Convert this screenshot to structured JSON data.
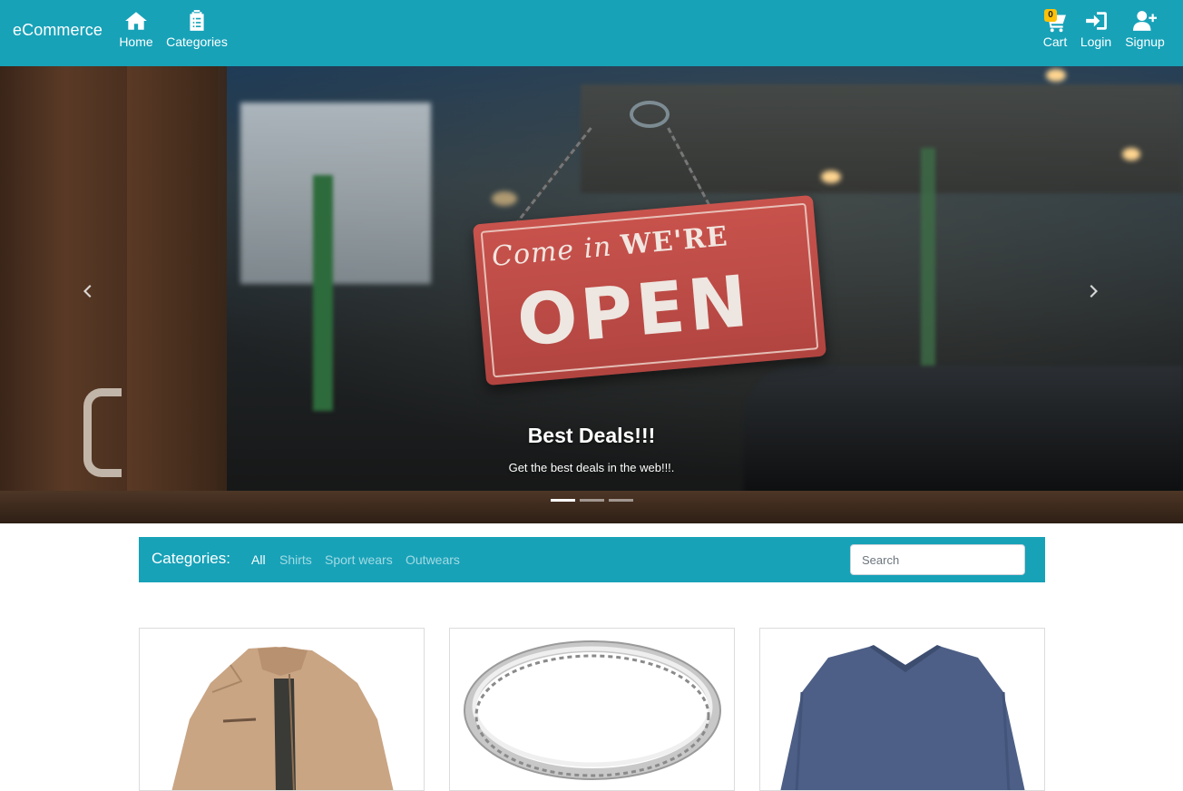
{
  "navbar": {
    "brand": "eCommerce",
    "home_label": "Home",
    "categories_label": "Categories",
    "cart_label": "Cart",
    "cart_count": "0",
    "login_label": "Login",
    "signup_label": "Signup"
  },
  "carousel": {
    "caption_title": "Best Deals!!!",
    "caption_text": "Get the best deals in the web!!!.",
    "sign_script": "Come in",
    "sign_top": "WE'RE",
    "sign_main": "OPEN",
    "slide_count": 3,
    "active_slide": 1
  },
  "categories_bar": {
    "title": "Categories:",
    "links": [
      "All",
      "Shirts",
      "Sport wears",
      "Outwears"
    ],
    "active": "All",
    "search_placeholder": "Search"
  },
  "colors": {
    "primary": "#17a2b8",
    "badge": "#ffc107"
  },
  "products": [
    {
      "image": "beige-jacket"
    },
    {
      "image": "silver-ring"
    },
    {
      "image": "blue-sweater"
    }
  ]
}
